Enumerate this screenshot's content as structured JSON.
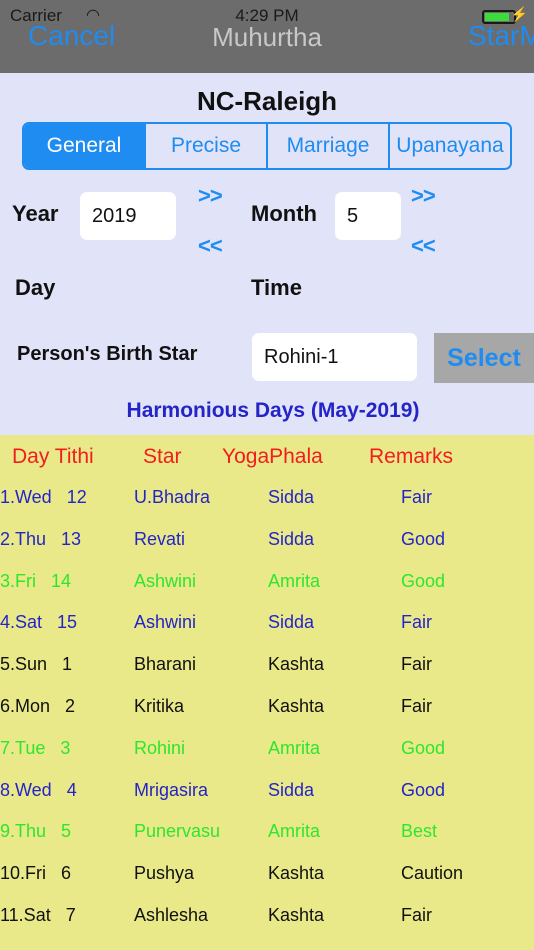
{
  "status_bar": {
    "carrier": "Carrier",
    "time": "4:29 PM"
  },
  "nav": {
    "left": "Cancel",
    "title": "Muhurtha",
    "right": "StarM"
  },
  "location": "NC-Raleigh",
  "segments": [
    {
      "label": "General",
      "active": true
    },
    {
      "label": "Precise",
      "active": false
    },
    {
      "label": "Marriage",
      "active": false
    },
    {
      "label": "Upanayana",
      "active": false
    }
  ],
  "form": {
    "year_label": "Year",
    "year_value": "2019",
    "month_label": "Month",
    "month_value": "5",
    "next": ">>",
    "prev": "<<",
    "day_label": "Day",
    "time_label": "Time",
    "birth_star_label": "Person's Birth Star",
    "birth_star_value": "Rohini-1",
    "select_label": "Select"
  },
  "harmonious_title": "Harmonious Days (May-2019)",
  "table": {
    "headers": [
      "Day Tithi",
      "Star",
      "YogaPhala",
      "Remarks"
    ],
    "colors": {
      "header": "#f01e1e",
      "blue": "#2424c8",
      "green": "#2ee62e",
      "black": "#111111"
    },
    "rows": [
      {
        "day": "1.Wed   12",
        "star": "U.Bhadra",
        "yoga": "Sidda",
        "remark": "Fair",
        "color": "#2424c8"
      },
      {
        "day": "2.Thu   13",
        "star": "Revati",
        "yoga": "Sidda",
        "remark": "Good",
        "color": "#2424c8"
      },
      {
        "day": "3.Fri   14",
        "star": "Ashwini",
        "yoga": "Amrita",
        "remark": "Good",
        "color": "#2ee62e"
      },
      {
        "day": "4.Sat   15",
        "star": "Ashwini",
        "yoga": "Sidda",
        "remark": "Fair",
        "color": "#2424c8"
      },
      {
        "day": "5.Sun   1",
        "star": "Bharani",
        "yoga": "Kashta",
        "remark": "Fair",
        "color": "#111111"
      },
      {
        "day": "6.Mon   2",
        "star": "Kritika",
        "yoga": "Kashta",
        "remark": "Fair",
        "color": "#111111"
      },
      {
        "day": "7.Tue   3",
        "star": "Rohini",
        "yoga": "Amrita",
        "remark": "Good",
        "color": "#2ee62e"
      },
      {
        "day": "8.Wed   4",
        "star": "Mrigasira",
        "yoga": "Sidda",
        "remark": "Good",
        "color": "#2424c8"
      },
      {
        "day": "9.Thu   5",
        "star": "Punervasu",
        "yoga": "Amrita",
        "remark": "Best",
        "color": "#2ee62e"
      },
      {
        "day": "10.Fri   6",
        "star": "Pushya",
        "yoga": "Kashta",
        "remark": "Caution",
        "color": "#111111"
      },
      {
        "day": "11.Sat   7",
        "star": "Ashlesha",
        "yoga": "Kashta",
        "remark": "Fair",
        "color": "#111111"
      }
    ]
  }
}
